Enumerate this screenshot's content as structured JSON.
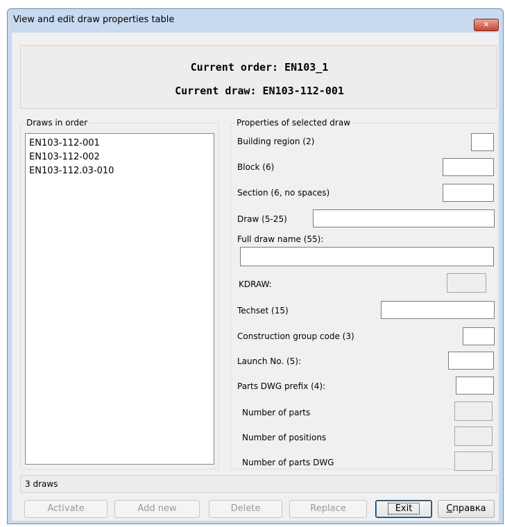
{
  "window": {
    "title": "View and edit draw properties table"
  },
  "header": {
    "order_line": "Current order: EN103_1",
    "draw_line": "Current draw: EN103-112-001"
  },
  "draws_group": {
    "legend": "Draws in order",
    "items": [
      "EN103-112-001",
      "EN103-112-002",
      "EN103-112.03-010"
    ]
  },
  "props_group": {
    "legend": "Properties of selected draw",
    "building_region": {
      "label": "Building region (2)",
      "value": ""
    },
    "block": {
      "label": "Block (6)",
      "value": ""
    },
    "section": {
      "label": "Section (6, no spaces)",
      "value": ""
    },
    "draw": {
      "label": "Draw (5-25)",
      "value": ""
    },
    "full_draw_name": {
      "label": "Full draw name (55):",
      "value": ""
    },
    "kdraw": {
      "label": "KDRAW:",
      "value": ""
    },
    "techset": {
      "label": "Techset (15)",
      "value": ""
    },
    "construction_group": {
      "label": "Construction group code (3)",
      "value": ""
    },
    "launch_no": {
      "label": "Launch No. (5):",
      "value": ""
    },
    "parts_dwg_prefix": {
      "label": "Parts DWG prefix (4):",
      "value": ""
    },
    "number_of_parts": {
      "label": "Number of parts",
      "value": ""
    },
    "number_of_positions": {
      "label": "Number of positions",
      "value": ""
    },
    "number_of_parts_dwg": {
      "label": "Number of parts DWG",
      "value": ""
    }
  },
  "status": {
    "text": "3 draws"
  },
  "buttons": {
    "activate": "Activate",
    "add_new": "Add new",
    "delete": "Delete",
    "replace": "Replace",
    "exit": "Exit",
    "help_accel": "С",
    "help_rest": "правка"
  },
  "icons": {
    "close": "close-icon"
  }
}
